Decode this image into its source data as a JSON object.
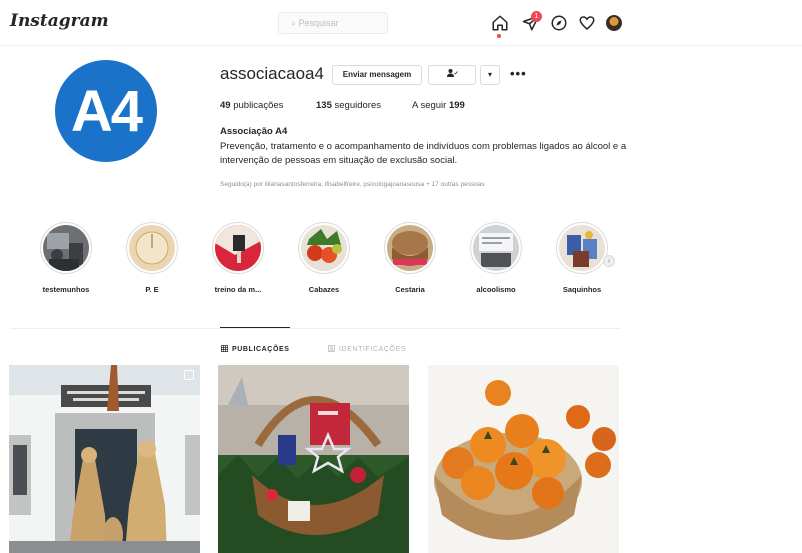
{
  "header": {
    "logo": "Instagram",
    "search_placeholder": "⌕ Pesquisar",
    "notification_count": "1"
  },
  "profile": {
    "avatar_text": "A4",
    "username": "associacaoa4",
    "message_button": "Enviar mensagem",
    "follow_button_icon": "▾",
    "more_label": "•••",
    "stats": {
      "posts_count": "49",
      "posts_label": "publicações",
      "followers_count": "135",
      "followers_label": "seguidores",
      "following_label": "A seguir",
      "following_count": "199"
    },
    "bio_name": "Associação A4",
    "bio_text": "Prevenção, tratamento e o acompanhamento de indivíduos com problemas ligados ao álcool e a intervenção de pessoas em situação de exclusão social.",
    "followed_by": "Seguido(a) por lilianasantosferreira, ifisabelfreire, psicologajoanasousa + 17 outras pessoas"
  },
  "highlights": [
    {
      "label": "testemunhos"
    },
    {
      "label": "P. E"
    },
    {
      "label": "treino da m..."
    },
    {
      "label": "Cabazes"
    },
    {
      "label": "Cestaria"
    },
    {
      "label": "alcoolismo"
    },
    {
      "label": "Saquinhos"
    }
  ],
  "tabs": {
    "posts": "PUBLICAÇÕES",
    "tagged": "IDENTIFICAÇÕES"
  },
  "colors": {
    "brand_blue": "#1a73c9",
    "notification_red": "#ed4956",
    "text": "#262626",
    "muted": "#8e8e8e"
  }
}
